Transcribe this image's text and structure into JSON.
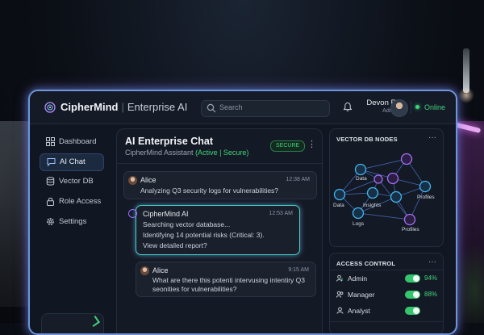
{
  "app": {
    "brand": "CipherMind",
    "subtitle": "Enterprise AI"
  },
  "search": {
    "placeholder": "Search"
  },
  "user": {
    "name": "Devon R.",
    "role": "Admin",
    "status": "Online"
  },
  "sidebar": {
    "items": [
      {
        "label": "Dashboard",
        "icon": "dashboard-icon"
      },
      {
        "label": "AI Chat",
        "icon": "chat-icon",
        "active": true
      },
      {
        "label": "Vector DB",
        "icon": "database-icon"
      },
      {
        "label": "Role Access",
        "icon": "lock-icon"
      },
      {
        "label": "Settings",
        "icon": "gear-icon"
      }
    ]
  },
  "chat": {
    "title": "AI Enterprise Chat",
    "assistant": "CipherMind Assistant",
    "status_text": "(Active | Secure)",
    "badge": "SECURE",
    "messages": [
      {
        "author": "Alice",
        "time": "12:38 AM",
        "lines": [
          "Analyzing Q3 security logs for vulnerabilities?"
        ]
      },
      {
        "author": "CipherMind AI",
        "time": "12:53 AM",
        "lines": [
          "Searching vector database...",
          "Identifying 14 potential risks (Critical: 3).",
          "View detailed report?"
        ]
      },
      {
        "author": "Alice",
        "time": "9:15 AM",
        "lines": [
          "What are there this potenti intervusing intentiry Q3",
          "seonities for vulnerabilities?"
        ]
      }
    ]
  },
  "vector_db": {
    "title": "VECTOR DB NODES",
    "labels": [
      "Data",
      "Data",
      "Insights",
      "Logs",
      "Profiles",
      "Profiles"
    ]
  },
  "access_control": {
    "title": "ACCESS CONTROL",
    "rows": [
      {
        "role": "Admin",
        "percent": "94%",
        "icon": "shield-user-icon"
      },
      {
        "role": "Manager",
        "percent": "88%",
        "icon": "users-icon"
      },
      {
        "role": "Analyst",
        "percent": "",
        "icon": "user-icon"
      }
    ]
  },
  "colors": {
    "accent": "#42d27a",
    "glow_cyan": "#3fd1c5",
    "glow_purple": "#a86ef0",
    "border_blue": "#6f95d8"
  }
}
